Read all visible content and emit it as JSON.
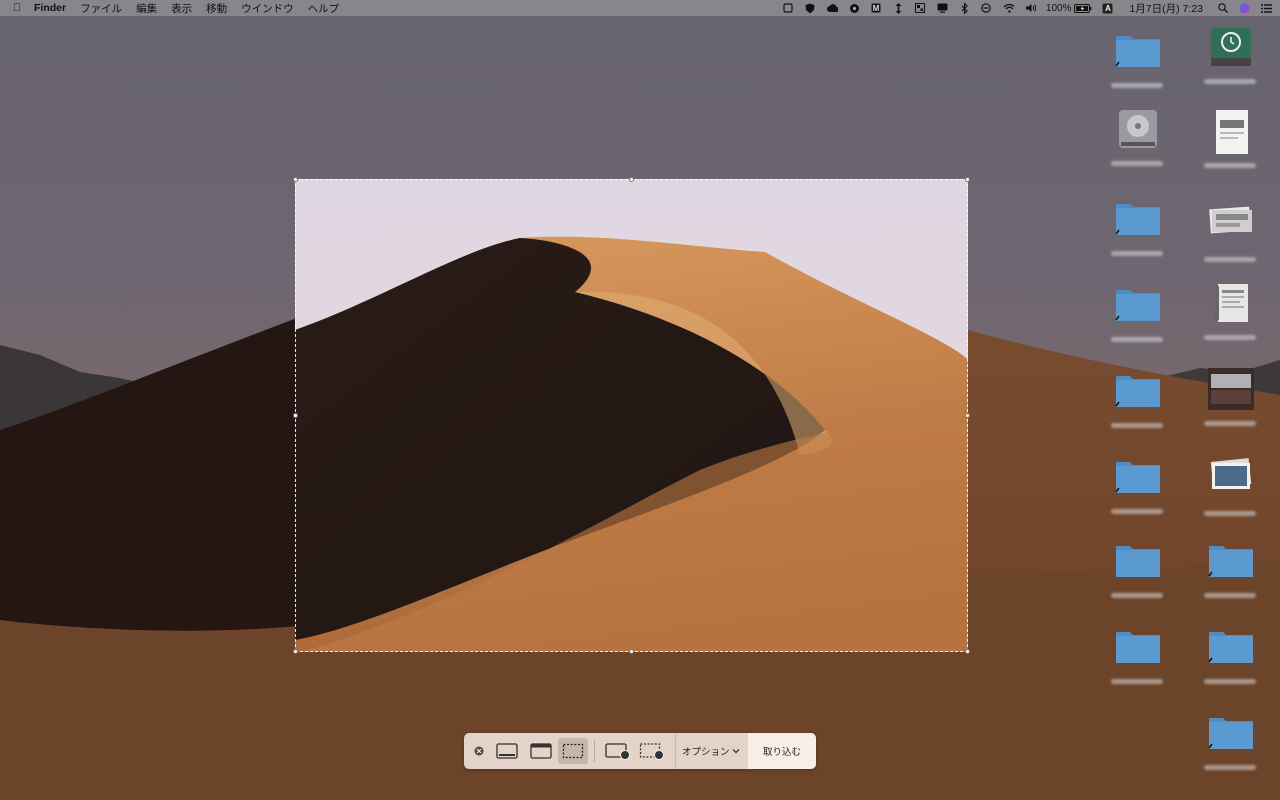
{
  "menubar": {
    "app_name": "Finder",
    "menus": [
      "ファイル",
      "編集",
      "表示",
      "移動",
      "ウインドウ",
      "ヘルプ"
    ],
    "battery": "100%",
    "clock": "1月7日(月)  7:23",
    "input_mode": "A"
  },
  "toolbar": {
    "options_label": "オプション",
    "capture_label": "取り込む"
  },
  "colors": {
    "folder": "#5b9ad0",
    "selection_border": "#ffffff",
    "toolbar_bg": "#eee0d6"
  }
}
